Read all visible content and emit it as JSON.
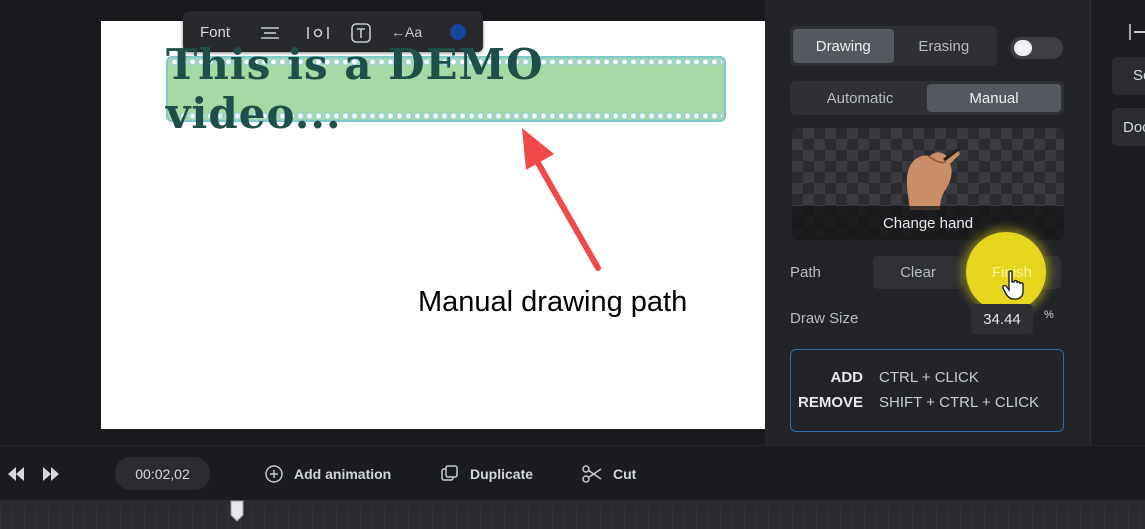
{
  "toolbar": {
    "font_label": "Font",
    "text_effect_label": "←Aa"
  },
  "canvas": {
    "demo_text": "This is a DEMO video...",
    "annotation": "Manual drawing path"
  },
  "panel": {
    "mode_tabs": [
      "Drawing",
      "Erasing"
    ],
    "path_tabs": [
      "Automatic",
      "Manual"
    ],
    "change_hand": "Change hand",
    "path_label": "Path",
    "clear_label": "Clear",
    "finish_label": "Finish",
    "draw_size_label": "Draw Size",
    "draw_size_value": "34.44",
    "draw_size_unit": "%",
    "shortcuts": [
      {
        "key": "ADD",
        "value": "CTRL + CLICK"
      },
      {
        "key": "REMOVE",
        "value": "SHIFT + CTRL + CLICK"
      }
    ]
  },
  "far_right": {
    "btn1": "Se",
    "btn2": "Doc"
  },
  "bottom": {
    "time": "00:02,02",
    "add_animation": "Add animation",
    "duplicate": "Duplicate",
    "cut": "Cut"
  },
  "colors": {
    "accent_blue": "#2f6fa8",
    "finish_yellow": "#e6d51d",
    "text_highlight": "#a6d9a6",
    "arrow_red": "#f0494a"
  }
}
